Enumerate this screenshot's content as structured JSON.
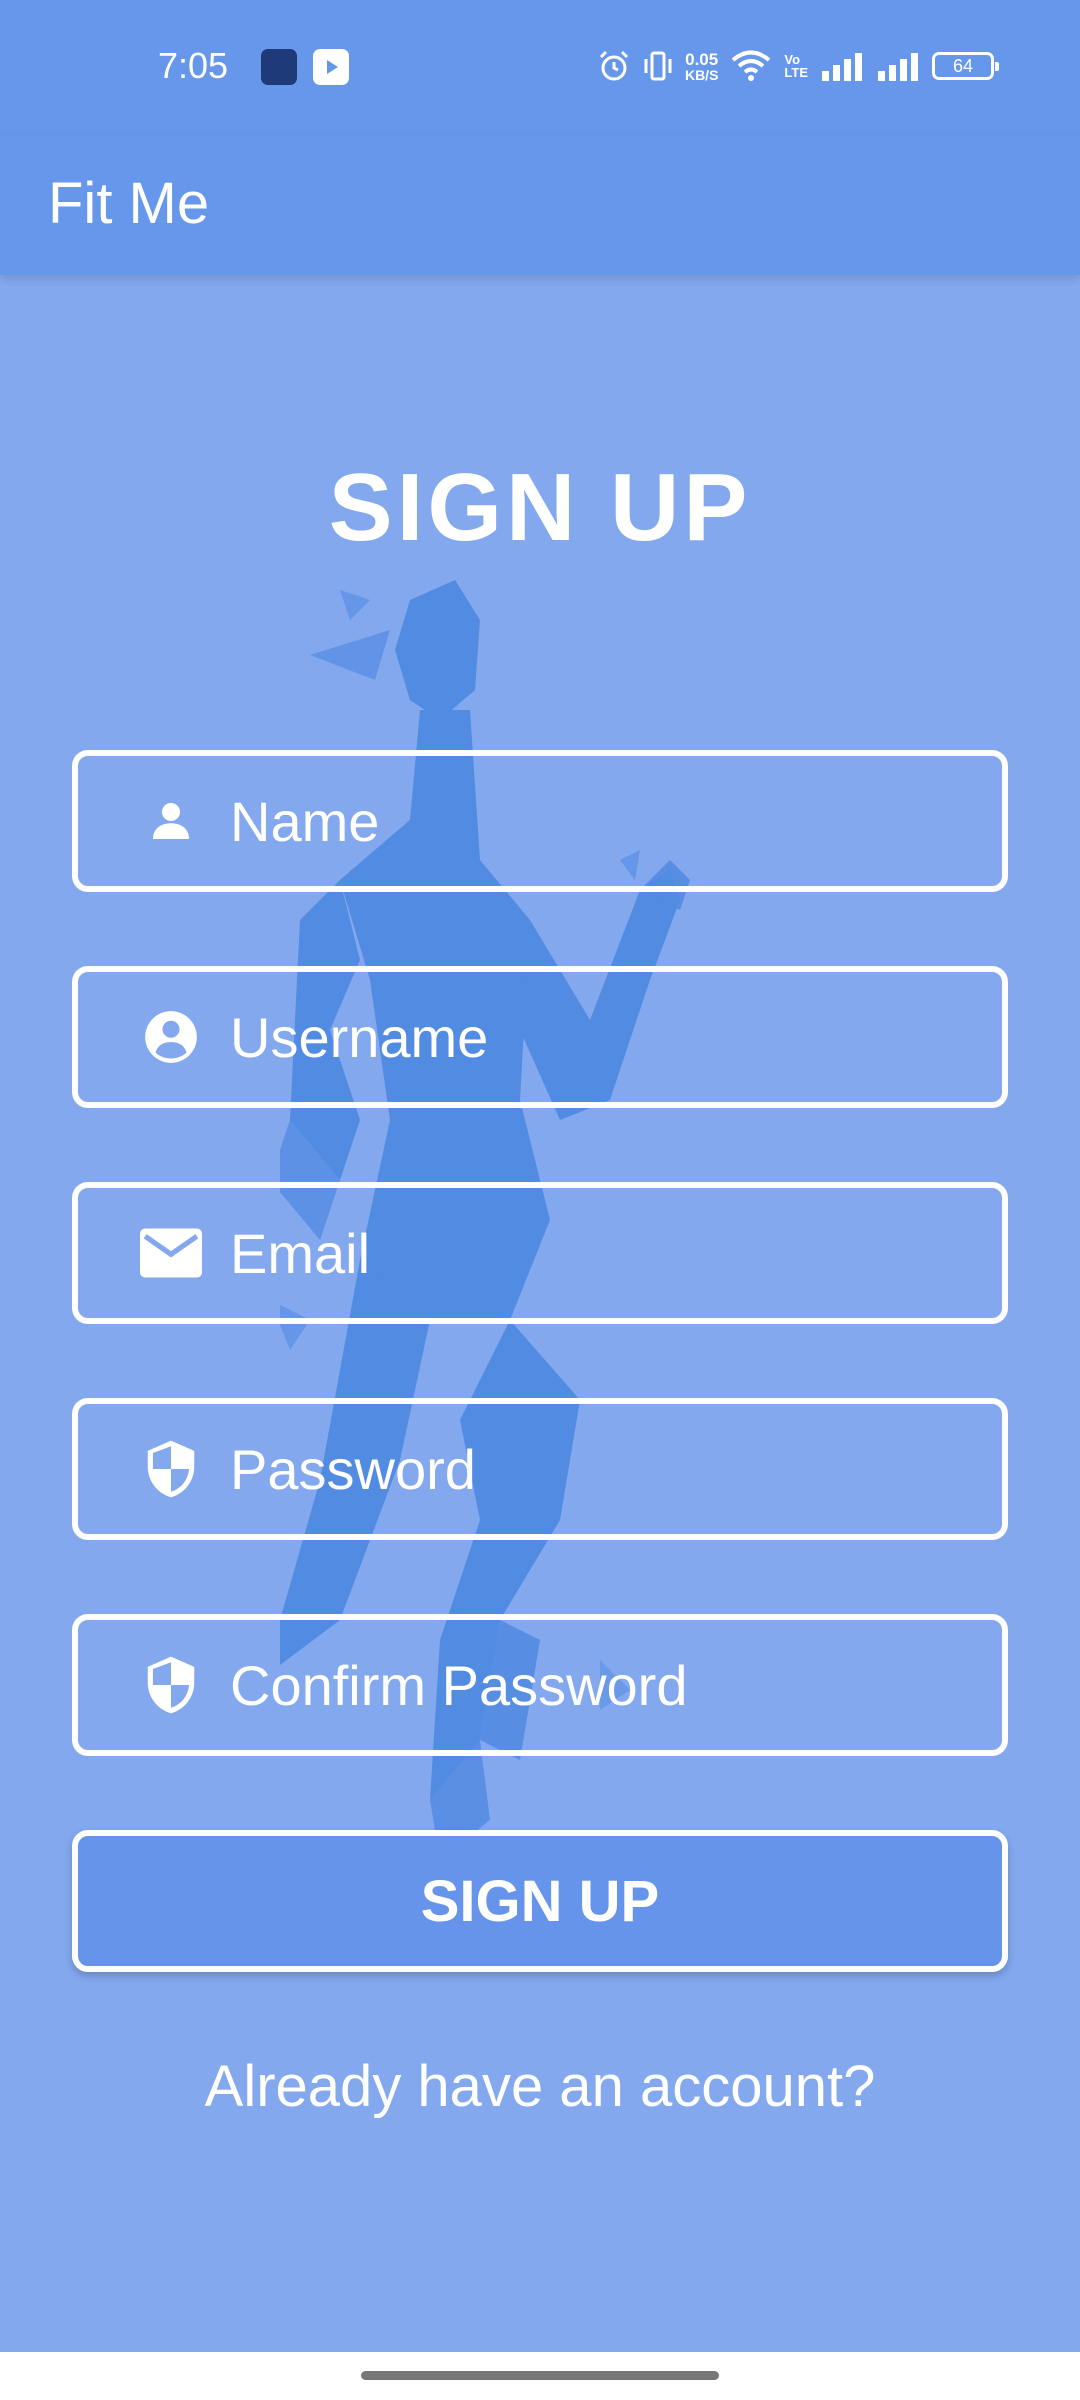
{
  "status_bar": {
    "time": "7:05",
    "net_speed_value": "0.05",
    "net_speed_unit": "KB/S",
    "volte_top": "Vo",
    "volte_bottom": "LTE",
    "battery": "64",
    "icons": [
      "app-notification-icon",
      "youtube-icon",
      "alarm-icon",
      "vibrate-icon",
      "wifi-icon",
      "signal-icon",
      "signal-icon",
      "battery-icon"
    ]
  },
  "app_bar": {
    "title": "Fit Me"
  },
  "form": {
    "heading": "SIGN UP",
    "fields": {
      "name": {
        "placeholder": "Name",
        "icon": "person-icon"
      },
      "username": {
        "placeholder": "Username",
        "icon": "account-circle-icon"
      },
      "email": {
        "placeholder": "Email",
        "icon": "mail-icon"
      },
      "password": {
        "placeholder": "Password",
        "icon": "shield-icon"
      },
      "confirm_password": {
        "placeholder": "Confirm Password",
        "icon": "shield-icon"
      }
    },
    "submit_label": "SIGN UP",
    "login_link": "Already have an account?"
  },
  "colors": {
    "background": "#83A8EE",
    "app_bar": "#6697EB",
    "button": "#6694EA",
    "figure": "#4A86E0",
    "text": "#FFFFFF"
  }
}
